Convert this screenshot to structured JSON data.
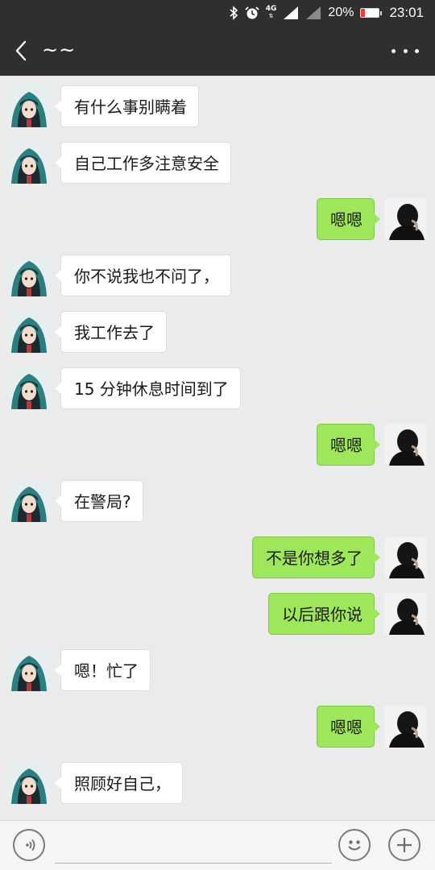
{
  "status_bar": {
    "network_label": "4G",
    "battery_percent": "20%",
    "battery_level": 0.2,
    "time": "23:01",
    "icons": [
      "bluetooth-icon",
      "alarm-icon",
      "signal-icon",
      "signal-icon",
      "battery-icon"
    ]
  },
  "header": {
    "title": "~~",
    "back_icon": "chevron-left-icon",
    "more_icon": "more-dots-icon"
  },
  "messages": [
    {
      "side": "left",
      "text": "有什么事别瞒着"
    },
    {
      "side": "left",
      "text": "自己工作多注意安全"
    },
    {
      "side": "right",
      "text": "嗯嗯"
    },
    {
      "side": "left",
      "text": "你不说我也不问了，"
    },
    {
      "side": "left",
      "text": "我工作去了"
    },
    {
      "side": "left",
      "text": "15 分钟休息时间到了"
    },
    {
      "side": "right",
      "text": "嗯嗯"
    },
    {
      "side": "left",
      "text": "在警局?"
    },
    {
      "side": "right",
      "text": "不是你想多了"
    },
    {
      "side": "right",
      "text": "以后跟你说"
    },
    {
      "side": "left",
      "text": "嗯！忙了"
    },
    {
      "side": "right",
      "text": "嗯嗯"
    },
    {
      "side": "left",
      "text": "照顾好自己，"
    }
  ],
  "input_bar": {
    "placeholder": "",
    "voice_icon": "voice-icon",
    "emoji_icon": "emoji-icon",
    "plus_icon": "plus-icon"
  },
  "colors": {
    "header_bg": "#2f2f2f",
    "chat_bg": "#ebebeb",
    "sent_bubble": "#9ee65a",
    "received_bubble": "#ffffff",
    "battery_low": "#e6413c"
  }
}
